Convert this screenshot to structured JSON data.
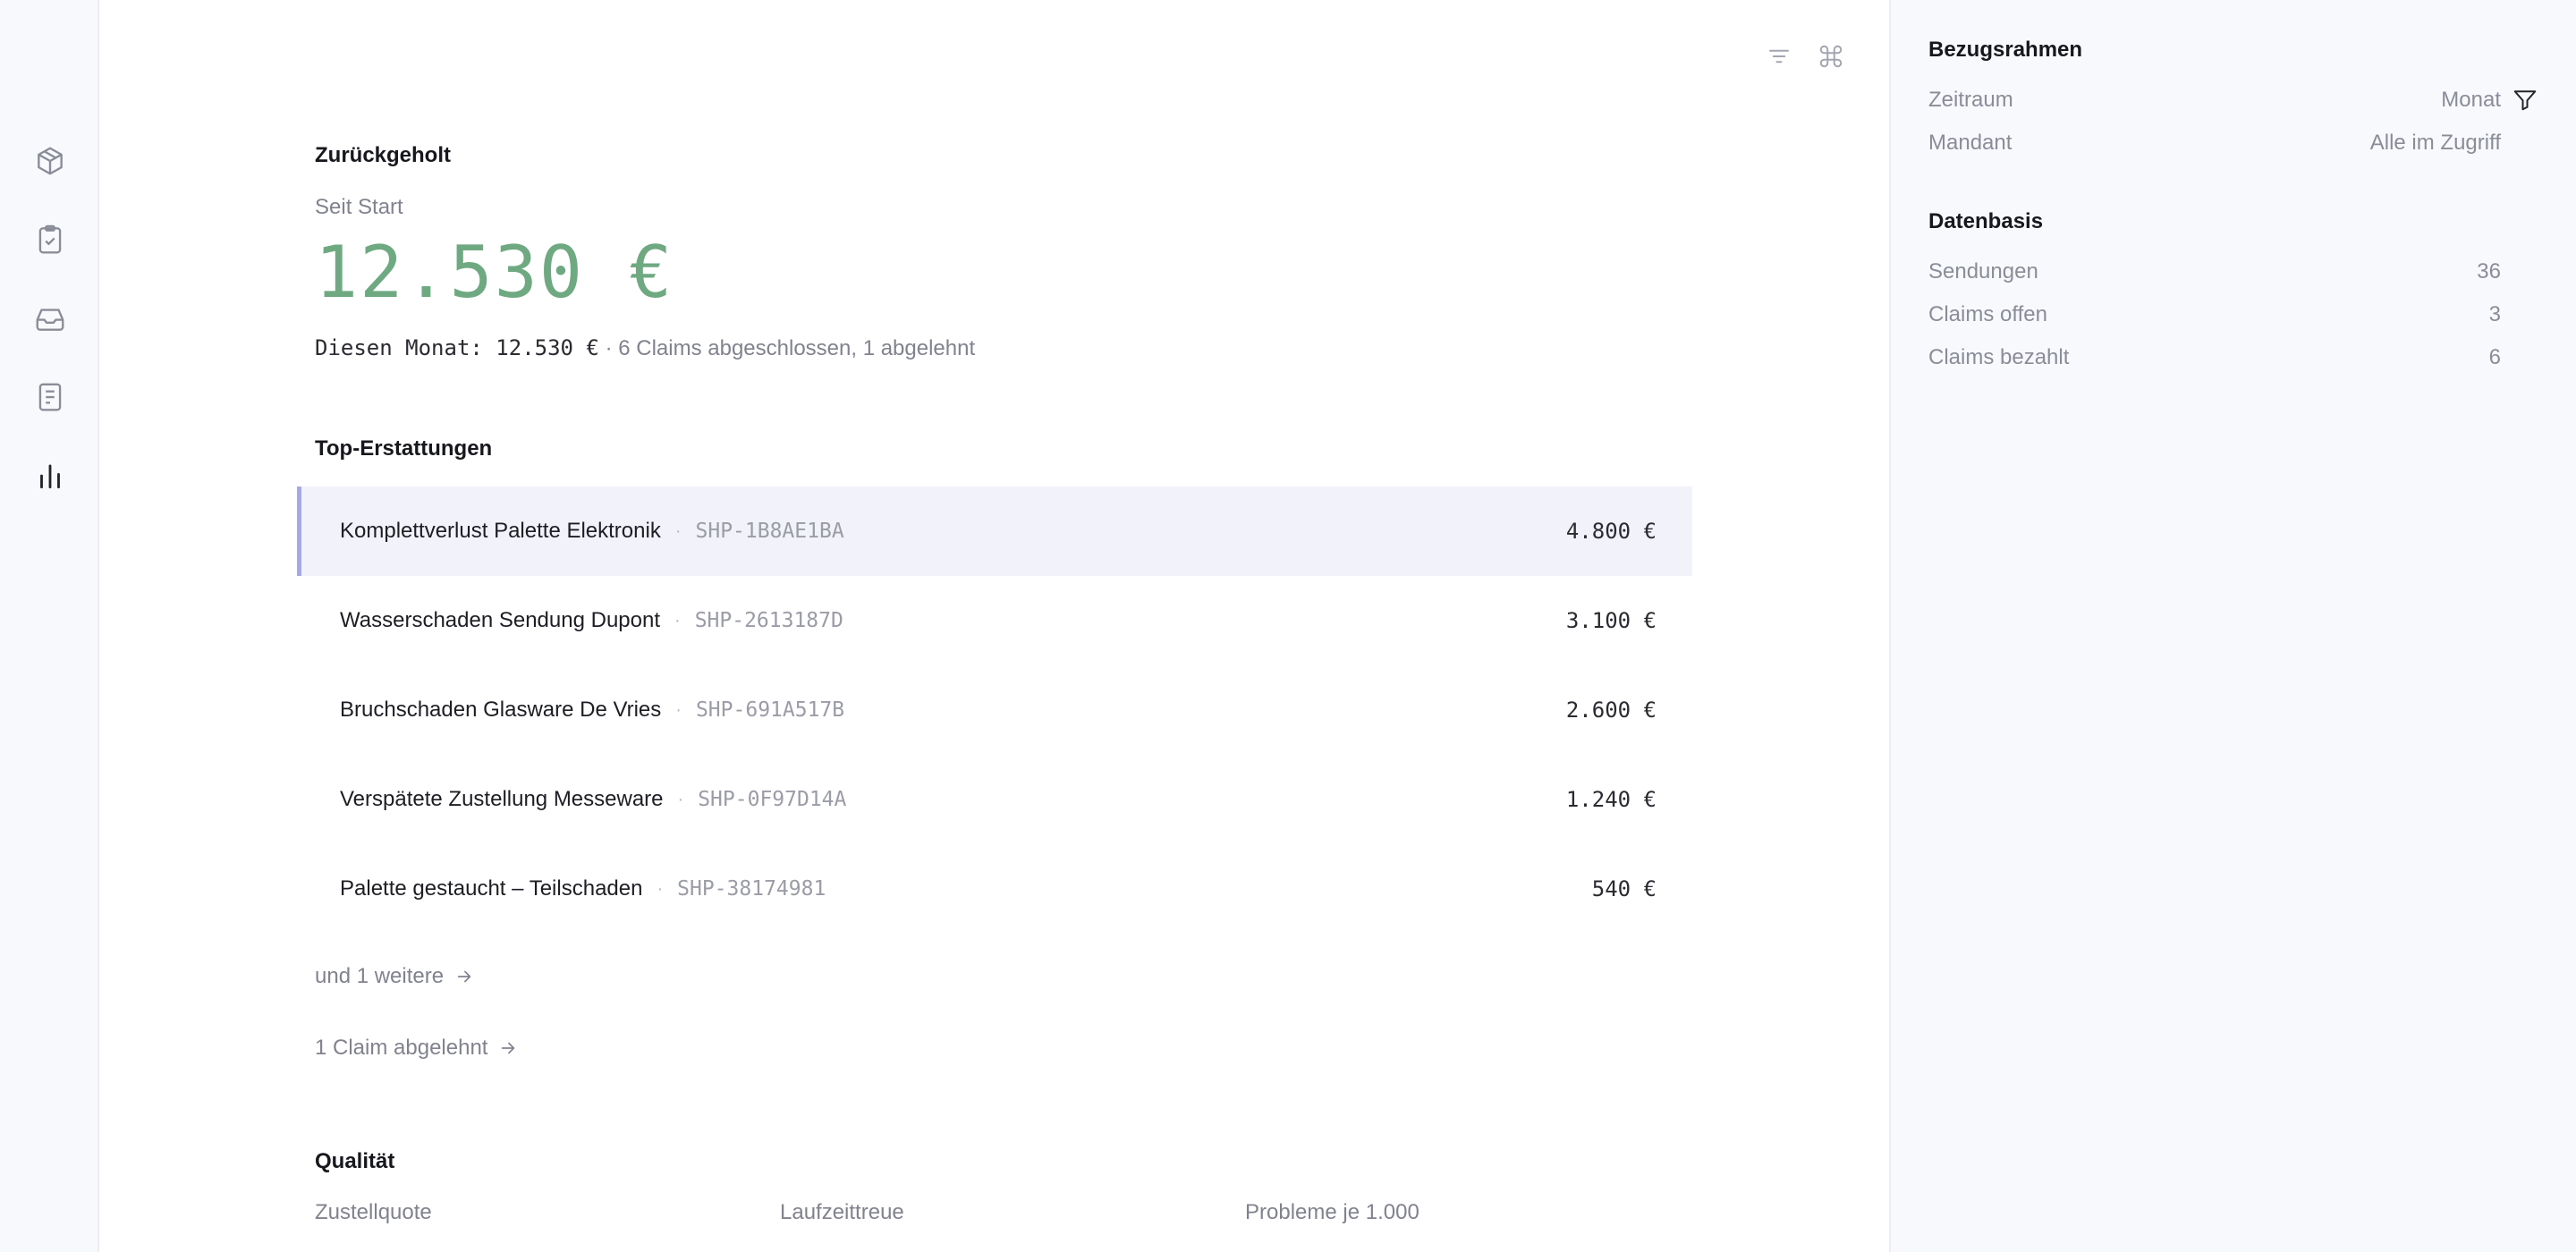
{
  "nav": {
    "items": [
      {
        "name": "packages",
        "icon": "package-icon"
      },
      {
        "name": "tasks",
        "icon": "clipboard-check-icon"
      },
      {
        "name": "inbox",
        "icon": "inbox-icon"
      },
      {
        "name": "documents",
        "icon": "document-icon"
      },
      {
        "name": "reports",
        "icon": "bar-chart-icon",
        "active": true
      }
    ]
  },
  "toolbar": {
    "icons": [
      "filter-lines-icon",
      "command-icon"
    ]
  },
  "recovered": {
    "title": "Zurückgeholt",
    "since_label": "Seit Start",
    "amount": "12.530 €",
    "month_label": "Diesen Monat: 12.530 €",
    "summary_rest": "· 6 Claims abgeschlossen, 1 abgelehnt"
  },
  "top_refunds": {
    "title": "Top-Erstattungen",
    "rows": [
      {
        "name": "Komplettverlust Palette Elektronik",
        "ref": "SHP-1B8AE1BA",
        "amount": "4.800 €",
        "highlight": true
      },
      {
        "name": "Wasserschaden Sendung Dupont",
        "ref": "SHP-2613187D",
        "amount": "3.100 €"
      },
      {
        "name": "Bruchschaden Glasware De Vries",
        "ref": "SHP-691A517B",
        "amount": "2.600 €"
      },
      {
        "name": "Verspätete Zustellung Messeware",
        "ref": "SHP-0F97D14A",
        "amount": "1.240 €"
      },
      {
        "name": "Palette gestaucht – Teilschaden",
        "ref": "SHP-38174981",
        "amount": "540 €"
      }
    ],
    "more_link": "und 1 weitere",
    "rejected_link": "1 Claim abgelehnt"
  },
  "quality": {
    "title": "Qualität",
    "metrics": [
      {
        "label": "Zustellquote"
      },
      {
        "label": "Laufzeittreue"
      },
      {
        "label": "Probleme je 1.000"
      }
    ]
  },
  "panel": {
    "frame_title": "Bezugsrahmen",
    "frame": [
      {
        "key": "Zeitraum",
        "value": "Monat"
      },
      {
        "key": "Mandant",
        "value": "Alle im Zugriff"
      }
    ],
    "basis_title": "Datenbasis",
    "basis": [
      {
        "key": "Sendungen",
        "value": "36"
      },
      {
        "key": "Claims offen",
        "value": "3"
      },
      {
        "key": "Claims bezahlt",
        "value": "6"
      }
    ]
  },
  "colors": {
    "accent_green": "#6fa982",
    "highlight_bg": "#f1f2fa",
    "highlight_bar": "#a7aade"
  }
}
